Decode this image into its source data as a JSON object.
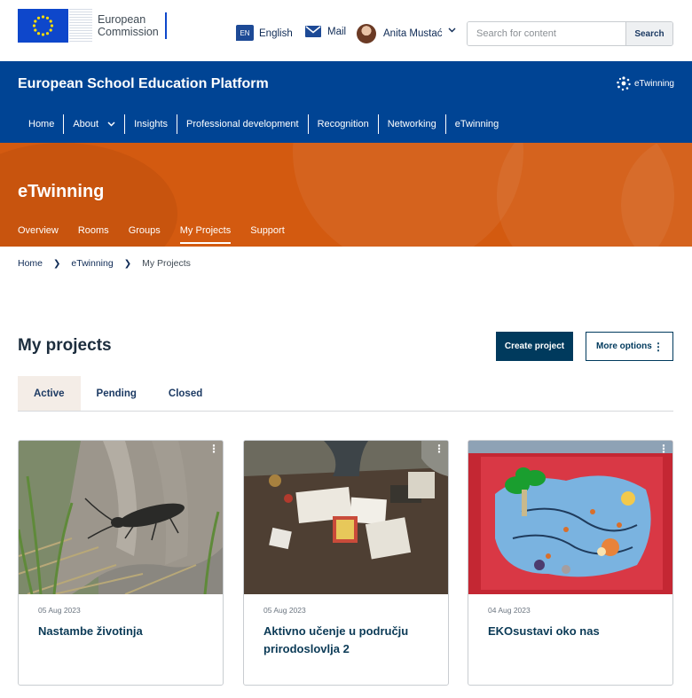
{
  "header": {
    "logo_line1": "European",
    "logo_line2": "Commission",
    "language_code": "EN",
    "language_label": "English",
    "mail_label": "Mail",
    "user_name": "Anita Mustać",
    "search_placeholder": "Search for content",
    "search_button": "Search"
  },
  "site": {
    "title": "European School Education Platform",
    "partner_logo": "eTwinning"
  },
  "main_nav": [
    {
      "label": "Home"
    },
    {
      "label": "About"
    },
    {
      "label": "Insights"
    },
    {
      "label": "Professional development"
    },
    {
      "label": "Recognition"
    },
    {
      "label": "Networking"
    },
    {
      "label": "eTwinning"
    }
  ],
  "banner": {
    "heading": "eTwinning",
    "tabs": [
      {
        "label": "Overview"
      },
      {
        "label": "Rooms"
      },
      {
        "label": "Groups"
      },
      {
        "label": "My Projects",
        "active": true
      },
      {
        "label": "Support"
      }
    ]
  },
  "breadcrumb": [
    "Home",
    "eTwinning",
    "My Projects"
  ],
  "projects": {
    "heading": "My projects",
    "create_button": "Create project",
    "more_button": "More options",
    "tabs": [
      {
        "label": "Active",
        "active": true
      },
      {
        "label": "Pending"
      },
      {
        "label": "Closed"
      }
    ],
    "cards": [
      {
        "date": "05 Aug 2023",
        "title": "Nastambe životinja",
        "image": "beetle-on-tree-photo"
      },
      {
        "date": "05 Aug 2023",
        "title": "Aktivno učenje u području prirodoslovlja 2",
        "image": "table-activity-photo"
      },
      {
        "date": "04 Aug 2023",
        "title": "EKOsustavi oko nas",
        "image": "ecosystem-diorama-photo"
      }
    ]
  },
  "colors": {
    "brand_blue": "#004494",
    "banner_orange": "#d35a10",
    "primary_button": "#003a5d"
  }
}
